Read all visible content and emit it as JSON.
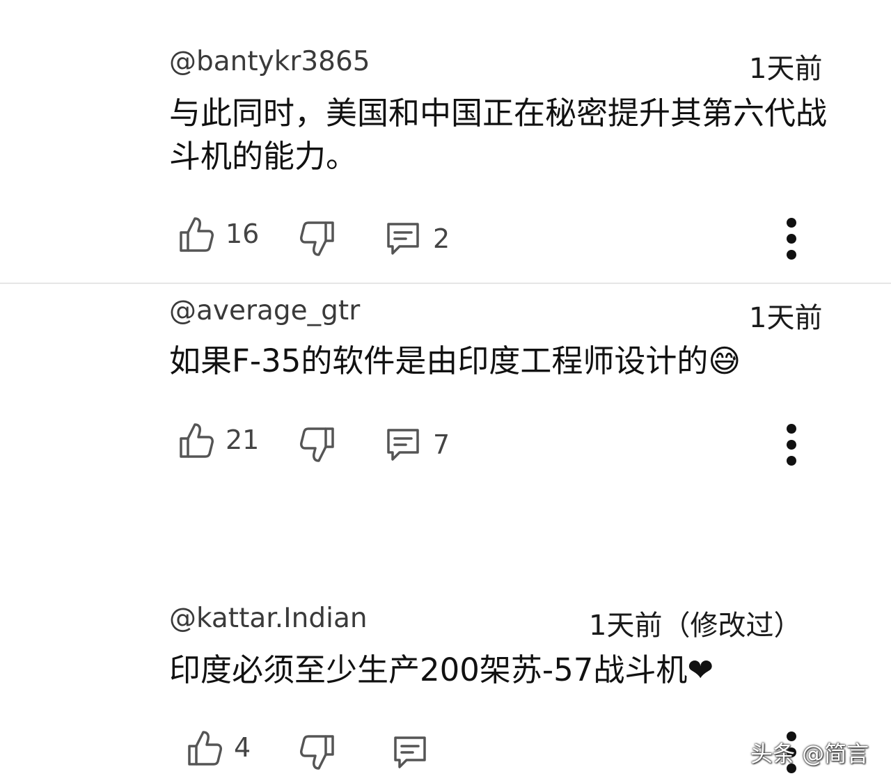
{
  "comments": [
    {
      "author": "@bantykr3865",
      "time": "1天前",
      "text": "与此同时，美国和中国正在秘密提升其第六代战斗机的能力。",
      "likes": "16",
      "replies": "2"
    },
    {
      "author": "@average_gtr",
      "time": "1天前",
      "text": "如果F-35的软件是由印度工程师设计的😅",
      "likes": "21",
      "replies": "7"
    },
    {
      "author": "@kattar.Indian",
      "time": "1天前（修改过）",
      "text": "印度必须至少生产200架苏-57战斗机❤",
      "likes": "4",
      "replies": ""
    }
  ],
  "watermark": "头条 @简言",
  "colors": {
    "background": "#ffffff",
    "text": "#0f0f0f",
    "muted": "#444444",
    "divider": "#e6e6e6"
  },
  "icons": [
    "like-icon",
    "dislike-icon",
    "reply-icon",
    "more-vert-icon"
  ]
}
